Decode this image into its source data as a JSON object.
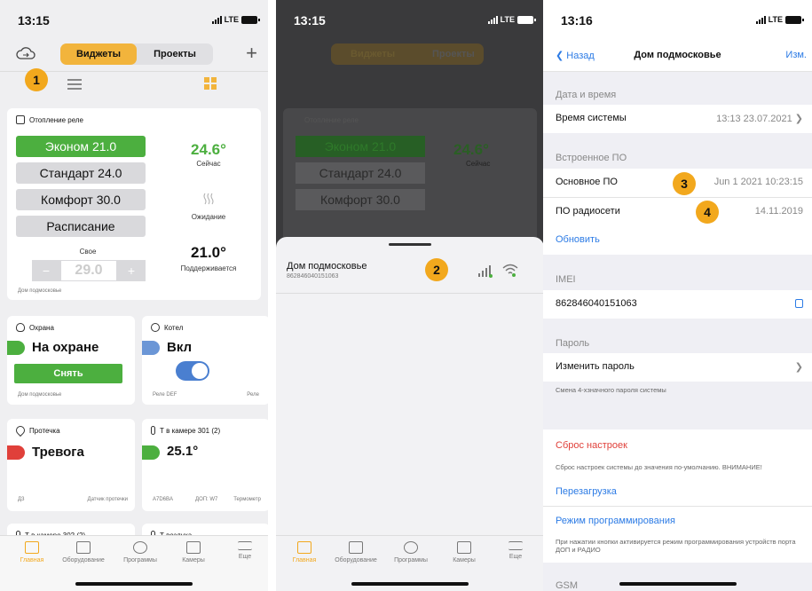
{
  "panel1": {
    "time": "13:15",
    "network": "LTE",
    "tabs": {
      "widgets": "Виджеты",
      "projects": "Проекты"
    },
    "plus": "+",
    "badge": "1",
    "heating": {
      "title": "Отопление реле",
      "modes": [
        "Эконом 21.0",
        "Стандарт 24.0",
        "Комфорт 30.0",
        "Расписание"
      ],
      "current_temp": "24.6°",
      "current_label": "Сейчас",
      "waiting_label": "Ожидание",
      "own_label": "Свое",
      "own_value": "29.0",
      "minus": "−",
      "plus": "+",
      "target_temp": "21.0°",
      "target_label": "Поддерживается",
      "location": "Дом подмосковье"
    },
    "security": {
      "title": "Охрана",
      "state": "На охране",
      "button": "Снять",
      "location": "Дом подмосковье"
    },
    "boiler": {
      "title": "Котел",
      "state": "Вкл",
      "left": "Реле DEF",
      "right": "Реле"
    },
    "leak": {
      "title": "Протечка",
      "state": "Тревога",
      "left": "Д3",
      "right": "Датчик протечки"
    },
    "chamber301": {
      "title": "Т в камере 301 (2)",
      "value": "25.1°",
      "a": "A7D6BA",
      "b": "ДОП: W7",
      "c": "Термометр"
    },
    "chamber302": {
      "title": "Т в камере 302 (2)"
    },
    "air": {
      "title": "Т воздуха"
    }
  },
  "tabbar": [
    "Главная",
    "Оборудование",
    "Программы",
    "Камеры",
    "Еще"
  ],
  "panel2": {
    "time": "13:15",
    "network": "LTE",
    "badge": "2",
    "device_name": "Дом подмосковье",
    "device_id": "862846040151063",
    "ghost": {
      "widgets": "Виджеты",
      "projects": "Проекты",
      "title": "Отопление реле",
      "modes": [
        "Эконом 21.0",
        "Стандарт 24.0",
        "Комфорт 30.0"
      ],
      "temp": "24.6°",
      "now": "Сейчас"
    }
  },
  "panel3": {
    "time": "13:16",
    "network": "LTE",
    "back": "Назад",
    "title": "Дом подмосковье",
    "edit": "Изм.",
    "sec_datetime": "Дата и время",
    "system_time_label": "Время системы",
    "system_time_value": "13:13 23.07.2021",
    "sec_firmware": "Встроенное ПО",
    "main_fw_label": "Основное ПО",
    "main_fw_value": "Jun  1 2021 10:23:15",
    "radio_fw_label": "ПО радиосети",
    "radio_fw_value": "14.11.2019",
    "badge3": "3",
    "badge4": "4",
    "update": "Обновить",
    "sec_imei": "IMEI",
    "imei": "862846040151063",
    "sec_password": "Пароль",
    "change_password": "Изменить пароль",
    "password_note": "Смена 4-хзначного пароля системы",
    "reset": "Сброс настроек",
    "reset_note": "Сброс настроек системы до значения по-умолчанию. ВНИМАНИЕ!",
    "reboot": "Перезагрузка",
    "prog_mode": "Режим программирования",
    "prog_note": "При нажатии кнопки активируется режим программирования устройств порта ДОП и РАДИО",
    "sec_gsm": "GSM"
  },
  "colors": {
    "accent": "#f2a81d",
    "green": "#4caf3f",
    "red": "#e0403a",
    "blue": "#2c7be5"
  }
}
